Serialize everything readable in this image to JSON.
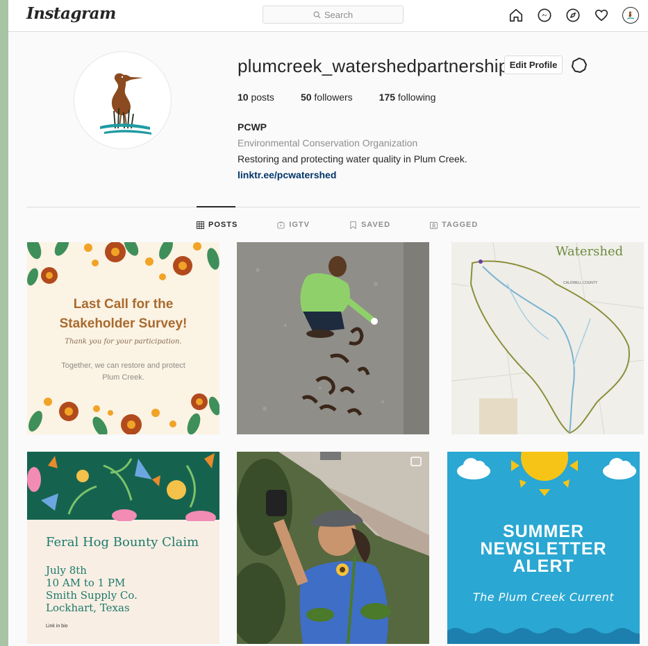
{
  "app": {
    "logo_text": "Instagram",
    "search_placeholder": "Search"
  },
  "nav": {
    "icons": [
      "home-icon",
      "messenger-icon",
      "explore-compass-icon",
      "activity-heart-icon",
      "profile-avatar-icon"
    ]
  },
  "profile": {
    "username": "plumcreek_watershedpartnership",
    "edit_button": "Edit Profile",
    "stats": {
      "posts_count": "10",
      "posts_label": "posts",
      "followers_count": "50",
      "followers_label": "followers",
      "following_count": "175",
      "following_label": "following"
    },
    "bio": {
      "name": "PCWP",
      "category": "Environmental Conservation Organization",
      "description": "Restoring and protecting water quality in Plum Creek.",
      "link": "linktr.ee/pcwatershed"
    }
  },
  "tabs": [
    {
      "label": "POSTS",
      "active": true
    },
    {
      "label": "IGTV",
      "active": false
    },
    {
      "label": "SAVED",
      "active": false
    },
    {
      "label": "TAGGED",
      "active": false
    }
  ],
  "posts": {
    "survey": {
      "title_line1": "Last Call for the",
      "title_line2": "Stakeholder Survey!",
      "thanks": "Thank you for your participation.",
      "body_line1": "Together, we can restore and protect",
      "body_line2": "Plum Creek."
    },
    "watershed": {
      "title": "Watershed",
      "county_label": "CALDWELL COUNTY"
    },
    "hog": {
      "title": "Feral Hog Bounty Claim",
      "line1": "July 8th",
      "line2": "10 AM to 1 PM",
      "line3": "Smith Supply Co.",
      "line4": "Lockhart, Texas",
      "link": "Link in bio"
    },
    "newsletter": {
      "line1": "SUMMER",
      "line2": "NEWSLETTER",
      "line3": "ALERT",
      "subtitle": "The Plum Creek Current"
    }
  },
  "colors": {
    "link": "#003569",
    "survey_title": "#a86a2d",
    "hog_text": "#1d7a6a",
    "newsletter_bg": "#2aa7d2",
    "sidebar_green": "#a9c4a4"
  }
}
